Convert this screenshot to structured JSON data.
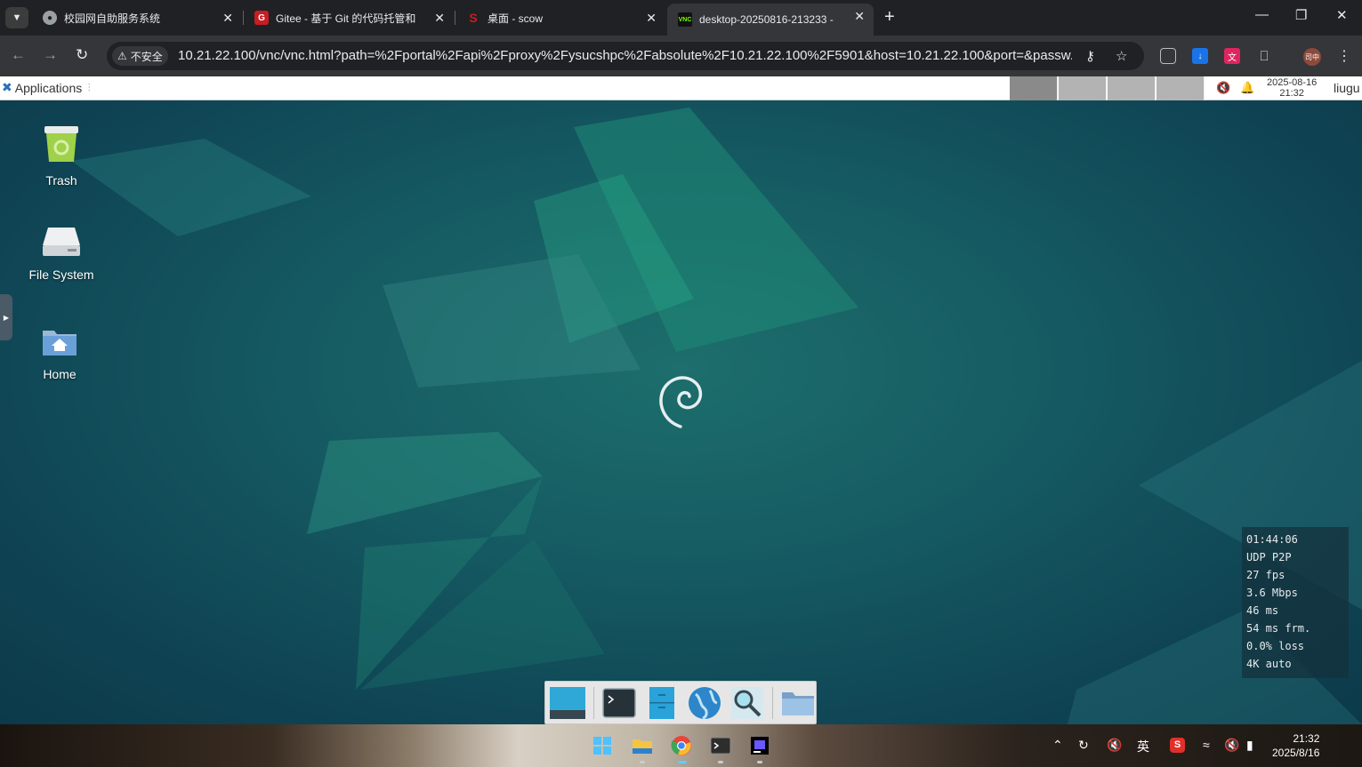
{
  "browser": {
    "tabs": [
      {
        "title": "校园网自助服务系统",
        "favicon": "globe-icon"
      },
      {
        "title": "Gitee - 基于 Git 的代码托管和",
        "favicon": "gitee-icon"
      },
      {
        "title": "桌面 - scow",
        "favicon": "scow-icon"
      },
      {
        "title": "desktop-20250816-213233 -",
        "favicon": "vnc-icon",
        "active": true
      }
    ],
    "insecure_label": "不安全",
    "url": "10.21.22.100/vnc/vnc.html?path=%2Fportal%2Fapi%2Fproxy%2Fysucshpc%2Fabsolute%2F10.21.22.100%2F5901&host=10.21.22.100&port=&passw...",
    "profile_label": "司中"
  },
  "xfce": {
    "applications_label": "Applications",
    "clock_date": "2025-08-16",
    "clock_time": "21:32",
    "user": "liugu",
    "workspaces": 4
  },
  "desktop_icons": [
    {
      "label": "Trash",
      "icon": "trash-icon"
    },
    {
      "label": "File System",
      "icon": "drive-icon"
    },
    {
      "label": "Home",
      "icon": "home-folder-icon"
    }
  ],
  "stats": {
    "time": "01:44:06",
    "protocol": "UDP P2P",
    "fps": "27 fps",
    "bandwidth": "3.6 Mbps",
    "latency": "46 ms",
    "frame": "54 ms frm.",
    "loss": "0.0% loss",
    "quality": "4K auto"
  },
  "dock": [
    "show-desktop-icon",
    "terminal-icon",
    "file-manager-icon",
    "web-browser-icon",
    "app-finder-icon",
    "folder-icon"
  ],
  "taskbar": {
    "ime_label": "英",
    "time": "21:32",
    "date": "2025/8/16"
  },
  "colors": {
    "browser_bg": "#202124",
    "toolbar_bg": "#35363a",
    "desktop_teal": "#155a62",
    "panel_bg": "#ffffff"
  }
}
